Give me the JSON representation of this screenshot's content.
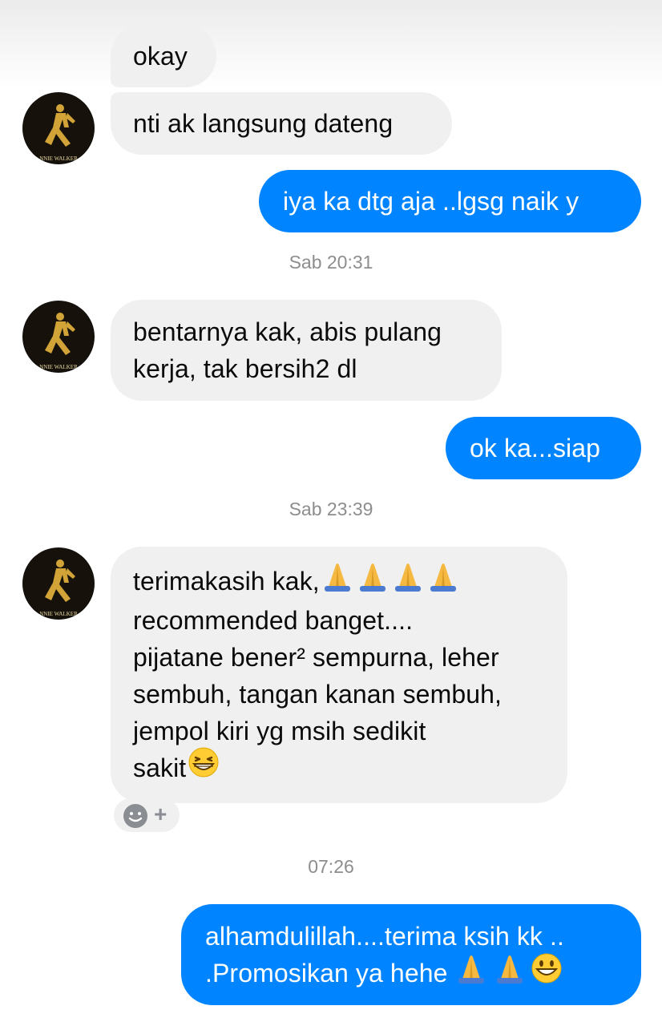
{
  "conversation": {
    "messages": [
      {
        "id": "m1",
        "lines": [
          "okay"
        ]
      },
      {
        "id": "m2",
        "lines": [
          "nti ak langsung dateng"
        ]
      },
      {
        "id": "m3",
        "lines": [
          "iya ka dtg aja ..lgsg naik y"
        ]
      },
      {
        "id": "m4",
        "lines": [
          "bentarnya kak, abis pulang",
          "kerja, tak bersih2 dl"
        ]
      },
      {
        "id": "m5",
        "lines": [
          "ok ka...siap"
        ]
      },
      {
        "id": "m6",
        "lines": [
          "terimakasih kak,",
          "recommended banget....",
          "pijatane bener² sempurna, leher",
          "sembuh, tangan kanan sembuh,",
          "jempol kiri yg msih sedikit",
          "sakit"
        ]
      },
      {
        "id": "m7",
        "lines": [
          "alhamdulillah....terima ksih kk ..",
          ".Promosikan ya hehe"
        ]
      }
    ],
    "timestamps": [
      "Sab 20:31",
      "Sab 23:39",
      "07:26"
    ],
    "avatar_text": "NNIE WALKER",
    "reaction_plus": "+"
  },
  "colors": {
    "outgoing_bubble": "#0084ff",
    "incoming_bubble": "#f0f0f0",
    "timestamp_text": "#8d8d8d",
    "outgoing_text": "#ffffff",
    "incoming_text": "#0a0a0a"
  },
  "icons": {
    "avatar": "striding-man-logo",
    "reaction": "smiley-reaction-icon",
    "emoji_folded_hands": "folded-hands-emoji",
    "emoji_grin": "grinning-squinting-face-emoji",
    "emoji_smile": "grinning-face-emoji"
  }
}
